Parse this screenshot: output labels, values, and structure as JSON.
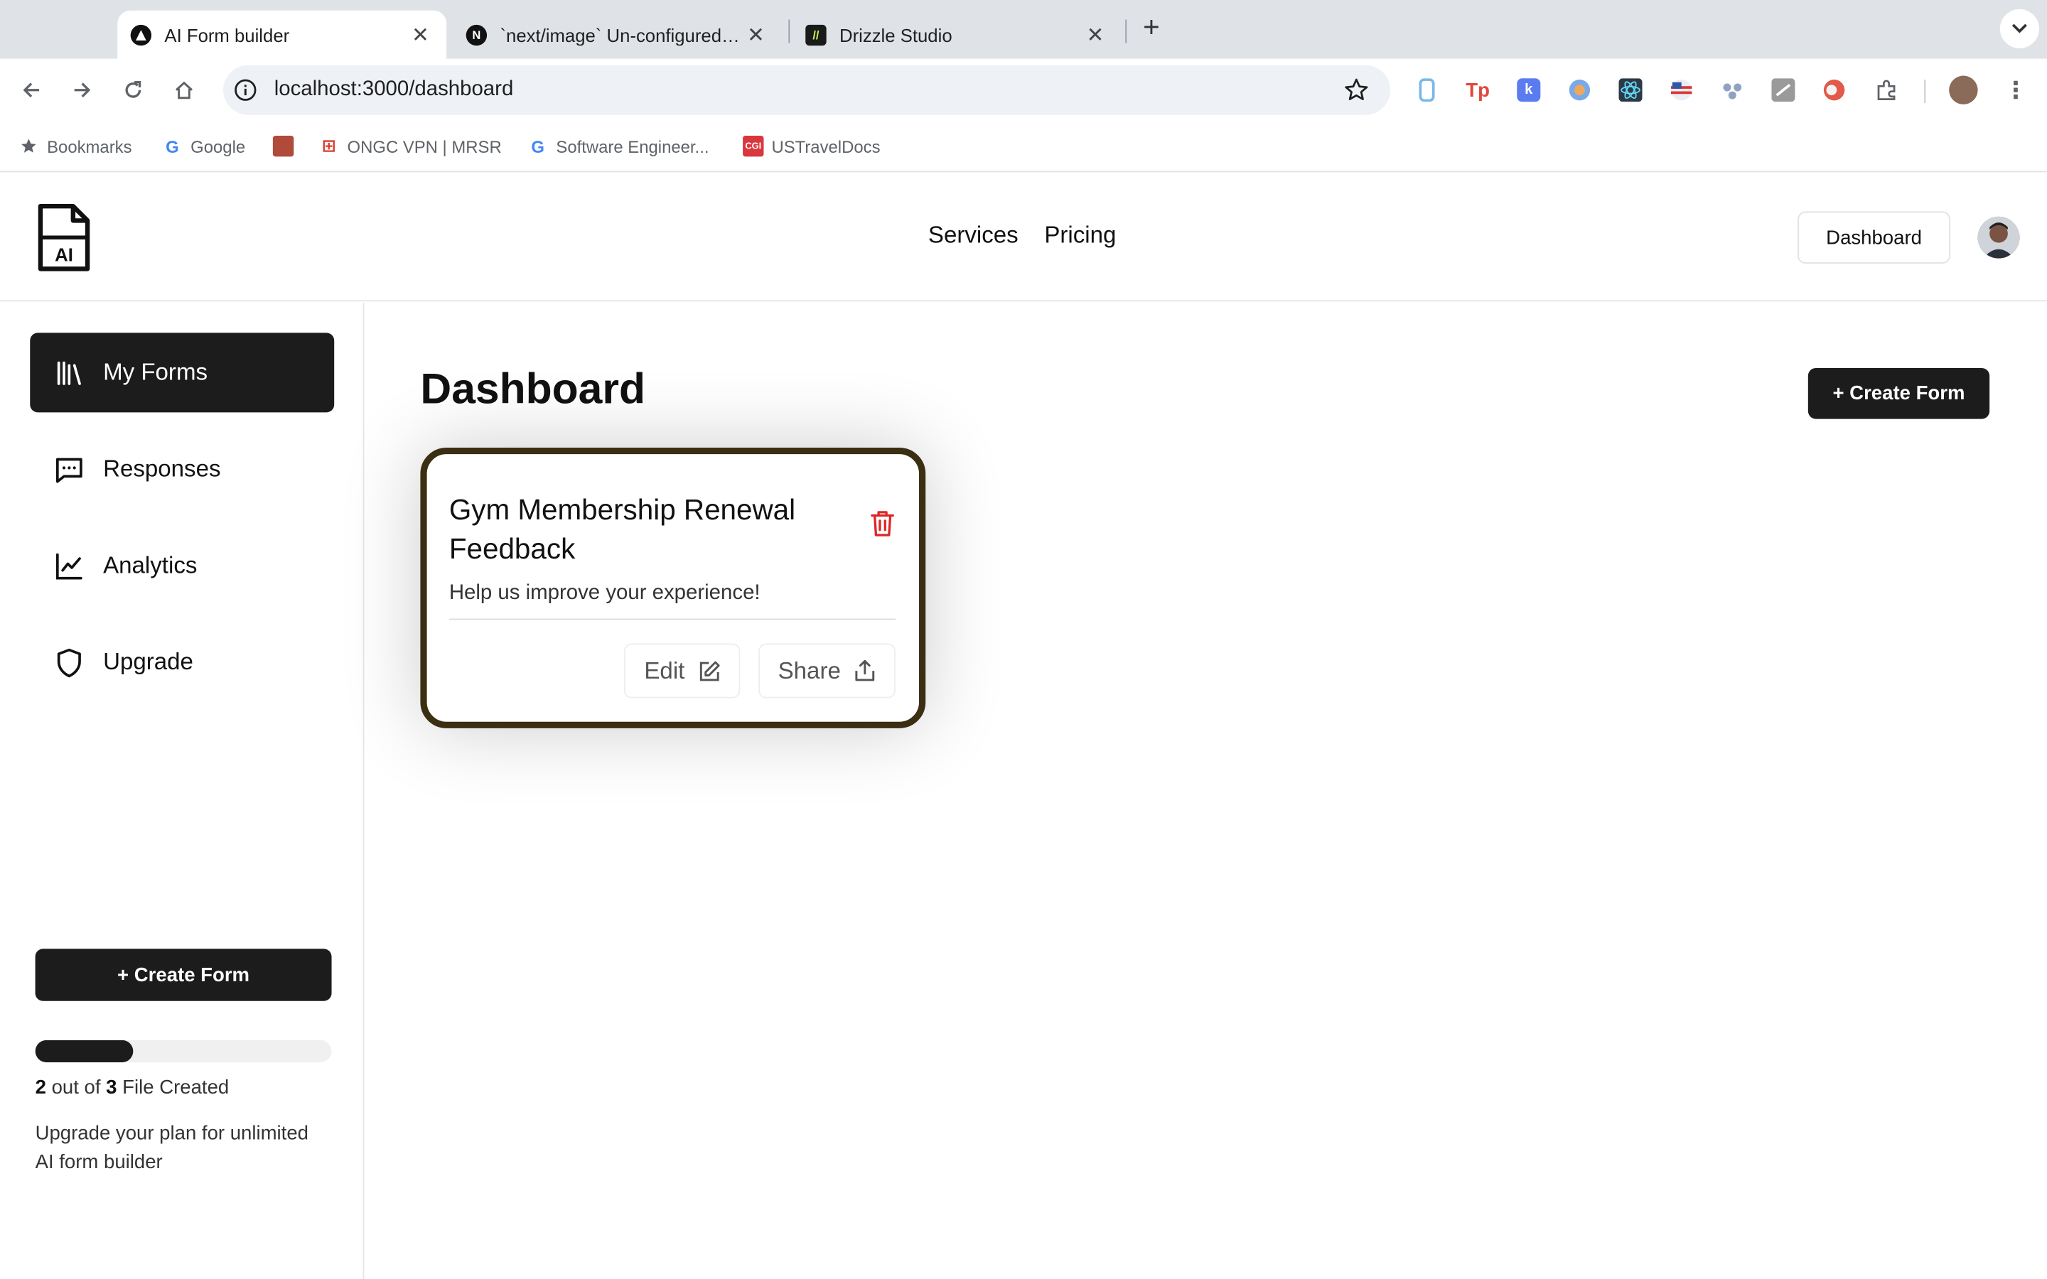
{
  "browser": {
    "tabs": [
      {
        "title": "AI Form builder",
        "active": true
      },
      {
        "title": "`next/image` Un-configured Host",
        "active": false
      },
      {
        "title": "Drizzle Studio",
        "active": false
      }
    ],
    "url": "localhost:3000/dashboard",
    "bookmarks": [
      {
        "label": "Bookmarks",
        "icon": "star-icon"
      },
      {
        "label": "Google",
        "icon": "google-icon"
      },
      {
        "label": "",
        "icon": "emblem-icon"
      },
      {
        "label": "ONGC VPN | MRSR",
        "icon": "fortinet-icon"
      },
      {
        "label": "Software Engineer...",
        "icon": "google-icon"
      },
      {
        "label": "USTravelDocs",
        "icon": "cgi-icon"
      }
    ]
  },
  "header": {
    "logo_text": "AI",
    "nav": [
      "Services",
      "Pricing"
    ],
    "dashboard_button": "Dashboard"
  },
  "sidebar": {
    "items": [
      {
        "label": "My Forms",
        "icon": "library-icon",
        "active": true
      },
      {
        "label": "Responses",
        "icon": "message-square-icon",
        "active": false
      },
      {
        "label": "Analytics",
        "icon": "line-chart-icon",
        "active": false
      },
      {
        "label": "Upgrade",
        "icon": "shield-icon",
        "active": false
      }
    ],
    "create_button": "+ Create Form",
    "usage": {
      "created": "2",
      "sep": "out of",
      "total": "3",
      "suffix": "File Created",
      "fraction": 0.33
    },
    "upsell": "Upgrade your plan for unlimited AI form builder"
  },
  "main": {
    "title": "Dashboard",
    "create_button": "+ Create Form",
    "forms": [
      {
        "title": "Gym Membership Renewal Feedback",
        "description": "Help us improve your experience!",
        "edit_label": "Edit",
        "share_label": "Share"
      }
    ]
  },
  "colors": {
    "primary": "#1c1c1c",
    "danger": "#dc2626",
    "card_border": "#3b2e12"
  }
}
